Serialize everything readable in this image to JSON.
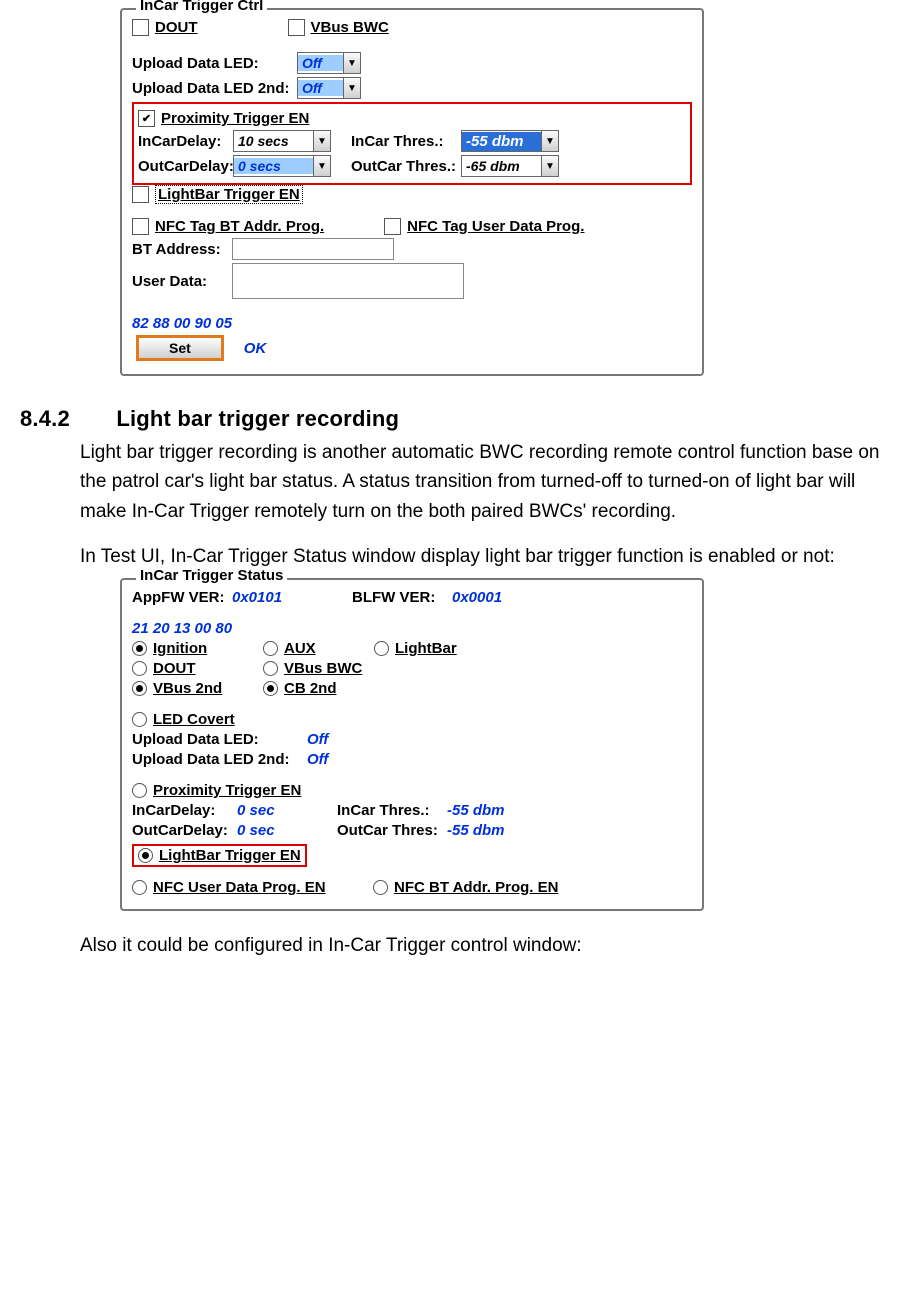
{
  "ctrl": {
    "legend": "InCar Trigger Ctrl",
    "dout": "DOUT",
    "vbus_bwc": "VBus BWC",
    "upload_led": "Upload Data LED:",
    "upload_led_2nd": "Upload Data LED 2nd:",
    "off": "Off",
    "prox_en": "Proximity Trigger EN",
    "incar_delay_lbl": "InCarDelay:",
    "incar_delay_val": "10 secs",
    "outcar_delay_lbl": "OutCarDelay:",
    "outcar_delay_val": "0 secs",
    "incar_thres_lbl": "InCar Thres.:",
    "incar_thres_val": "-55 dbm",
    "outcar_thres_lbl": "OutCar Thres.:",
    "outcar_thres_val": "-65 dbm",
    "lightbar_en": "LightBar Trigger EN",
    "nfc_bt": "NFC Tag BT Addr. Prog.",
    "nfc_ud": "NFC Tag User Data Prog.",
    "bt_addr": "BT Address:",
    "user_data": "User Data:",
    "hex": "82 88 00 90 05",
    "set": "Set",
    "ok": "OK"
  },
  "section": {
    "num": "8.4.2",
    "title": "Light bar trigger recording",
    "p1": "Light bar trigger recording is another automatic BWC recording remote control function base on the patrol car's light bar status. A status transition from turned-off to turned-on of light bar will make In-Car Trigger remotely turn on the both paired BWCs' recording.",
    "p2": "In Test UI, In-Car Trigger Status window display light bar trigger function is enabled or not:",
    "p3": "Also it could be configured in In-Car Trigger control window:"
  },
  "status": {
    "legend": "InCar Trigger Status",
    "appfw_lbl": "AppFW VER:",
    "appfw_val": "0x0101",
    "blfw_lbl": "BLFW VER:",
    "blfw_val": "0x0001",
    "hex": "21 20 13 00 80",
    "ignition": "Ignition",
    "aux": "AUX",
    "lightbar": "LightBar",
    "dout": "DOUT",
    "vbus_bwc": "VBus BWC",
    "vbus_2nd": "VBus 2nd",
    "cb_2nd": "CB 2nd",
    "led_covert": "LED Covert",
    "upload_led": "Upload Data LED:",
    "upload_led_2nd": "Upload Data LED 2nd:",
    "off": "Off",
    "prox_en": "Proximity Trigger EN",
    "incar_delay_lbl": "InCarDelay:",
    "incar_delay_val": "0 sec",
    "outcar_delay_lbl": "OutCarDelay:",
    "outcar_delay_val": "0 sec",
    "incar_thres_lbl": "InCar Thres.:",
    "incar_thres_val": "-55 dbm",
    "outcar_thres_lbl": "OutCar Thres:",
    "outcar_thres_val": "-55 dbm",
    "lightbar_en": "LightBar Trigger EN",
    "nfc_ud_en": "NFC User Data Prog. EN",
    "nfc_bt_en": "NFC BT Addr. Prog. EN"
  }
}
